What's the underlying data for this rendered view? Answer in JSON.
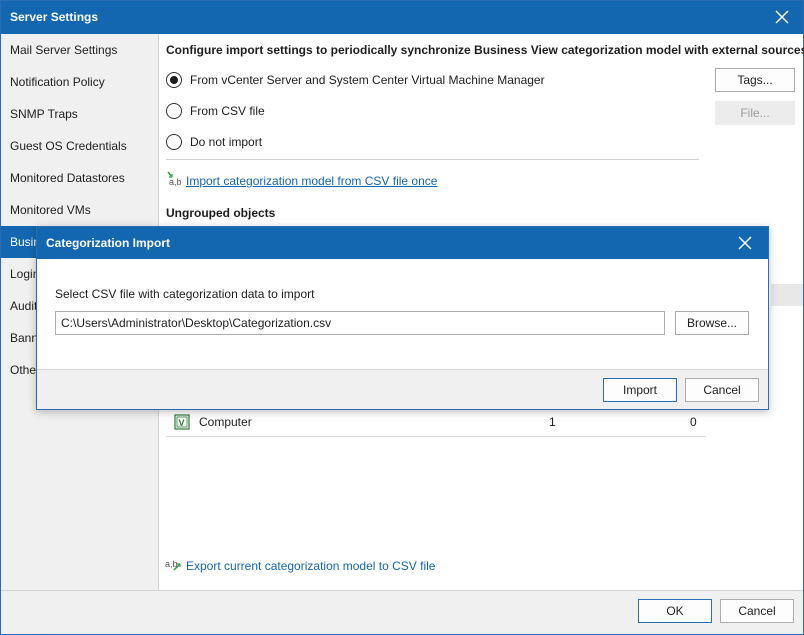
{
  "window": {
    "title": "Server Settings",
    "close_label": "×"
  },
  "sidebar": {
    "items": [
      {
        "label": "Mail Server Settings"
      },
      {
        "label": "Notification Policy"
      },
      {
        "label": "SNMP Traps"
      },
      {
        "label": "Guest OS Credentials"
      },
      {
        "label": "Monitored Datastores"
      },
      {
        "label": "Monitored VMs"
      },
      {
        "label": "Business View",
        "selected": true
      },
      {
        "label": "Login"
      },
      {
        "label": "Audit"
      },
      {
        "label": "Banner"
      },
      {
        "label": "Other"
      }
    ]
  },
  "main": {
    "heading": "Configure import settings to periodically synchronize Business View categorization model with external sources",
    "radios": [
      {
        "label": "From vCenter Server and System Center Virtual Machine Manager",
        "checked": true
      },
      {
        "label": "From CSV file",
        "checked": false
      },
      {
        "label": "Do not import",
        "checked": false
      }
    ],
    "tags_button": "Tags...",
    "file_button": "File...",
    "import_link": "Import categorization model from CSV file once",
    "ungrouped_heading": "Ungrouped objects",
    "table_rows": [
      {
        "name": "Computer",
        "col2": "1",
        "col3": "0"
      }
    ],
    "export_link": "Export current categorization model to CSV file"
  },
  "footer": {
    "ok_label": "OK",
    "cancel_label": "Cancel"
  },
  "dialog": {
    "title": "Categorization Import",
    "prompt": "Select CSV file with categorization data to import",
    "path_value": "C:\\Users\\Administrator\\Desktop\\Categorization.csv",
    "browse_label": "Browse...",
    "import_label": "Import",
    "cancel_label": "Cancel"
  },
  "colors": {
    "accent": "#1367b0",
    "link": "#1367b0",
    "sidebar_bg": "#f0f0f0"
  },
  "icons": {
    "window_close": "close-icon",
    "dialog_close": "close-icon",
    "import_link": "csv-import-icon",
    "export_link": "csv-export-icon",
    "computer_row": "vm-category-icon"
  }
}
